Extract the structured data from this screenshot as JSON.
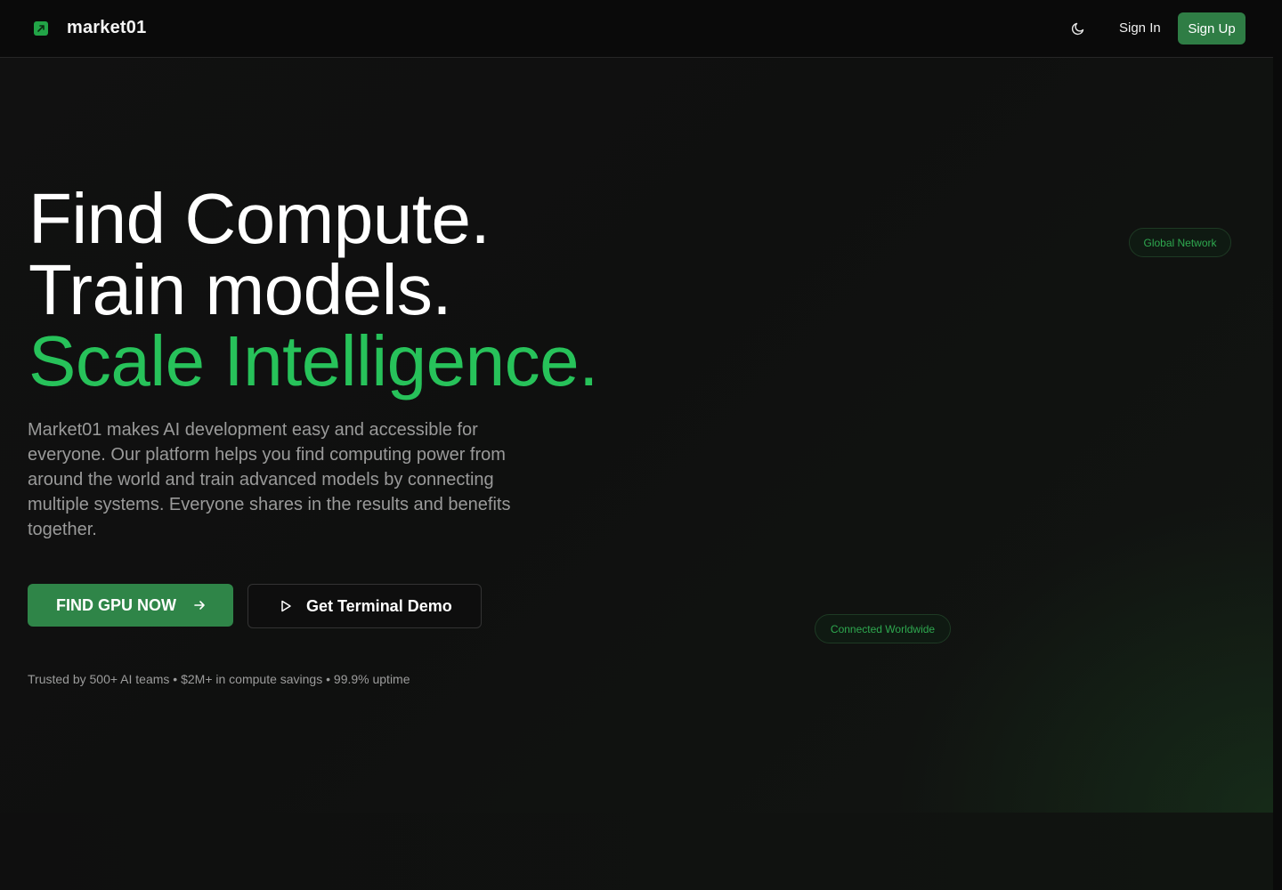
{
  "header": {
    "brand": "market01",
    "sign_in": "Sign In",
    "sign_up": "Sign Up",
    "theme_icon": "moon-icon",
    "logo_icon": "arrow-up-right-icon"
  },
  "hero": {
    "line1": "Find Compute.",
    "line2": "Train models.",
    "line3": "Scale Intelligence.",
    "description": "Market01 makes AI development easy and accessible for everyone. Our platform helps you find computing power from around the world and train advanced models by connecting multiple systems. Everyone shares in the results and benefits together.",
    "primary_cta": "FIND GPU NOW",
    "secondary_cta": "Get Terminal Demo",
    "trust_line": "Trusted by 500+ AI teams • $2M+ in compute savings • 99.9% uptime"
  },
  "badges": {
    "global": "Global Network",
    "connected": "Connected Worldwide"
  },
  "colors": {
    "accent": "#27c25a",
    "button": "#2f8548",
    "background": "#0d0d0d"
  }
}
